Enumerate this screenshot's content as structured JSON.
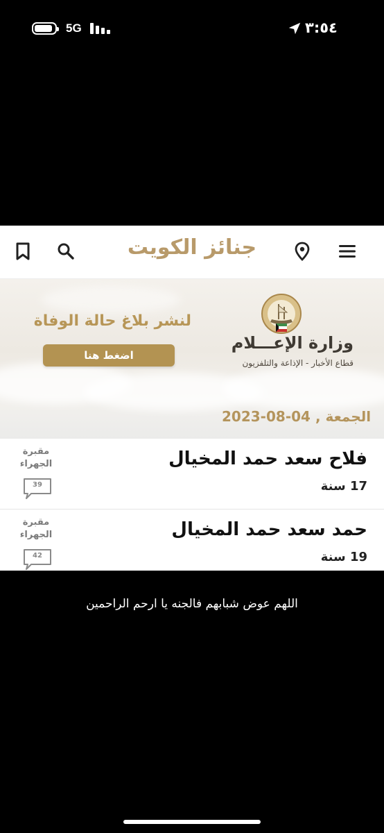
{
  "status_bar": {
    "time": "٣:٥٤",
    "network": "5G"
  },
  "webpage": {
    "site_title": "جنائز الكويت",
    "icons": [
      "menu-icon",
      "location-pin-icon",
      "search-icon",
      "bookmark-icon"
    ],
    "banner": {
      "cta_text": "لنشر بلاغ حالة الوفاة",
      "cta_button": "اضغط هنا",
      "ministry_name": "وزارة الإعـــلام",
      "ministry_sub": "قطاع الأخبار - الإذاعة والتلفزيون"
    },
    "date": "الجمعة , 04-08-2023",
    "obituaries": [
      {
        "name": "فلاح سعد حمد المخيال",
        "age": "17 سنة",
        "cemetery_line1": "مقبرة",
        "cemetery_line2": "الجهراء",
        "comments": "39"
      },
      {
        "name": "حمد سعد حمد المخيال",
        "age": "19 سنة",
        "cemetery_line1": "مقبرة",
        "cemetery_line2": "الجهراء",
        "comments": "42"
      }
    ]
  },
  "caption": "اللهم عوض شبابهم فالجنه يا  ارحم الراحمين",
  "colors": {
    "brand_gold": "#b89a6a",
    "button_gold": "#b39352",
    "background": "#000000"
  }
}
